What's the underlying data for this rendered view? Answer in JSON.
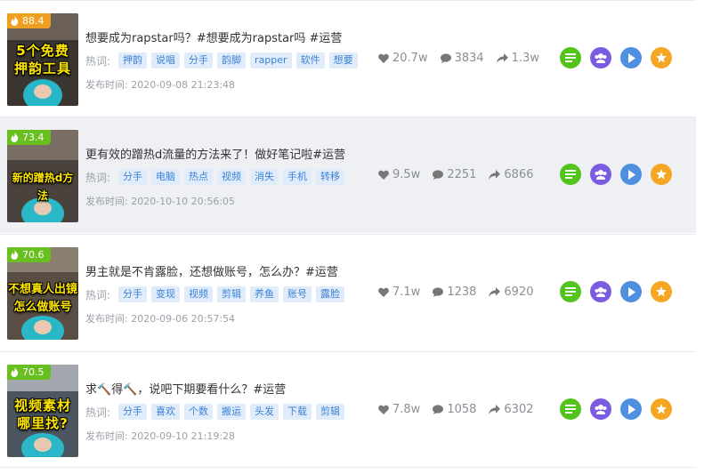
{
  "heat_label_icon": "flame-icon",
  "tags_label": "热词:",
  "time_label": "发布时间:",
  "actions": [
    "list-icon",
    "users-icon",
    "play-icon",
    "star-icon"
  ],
  "items": [
    {
      "heat": "88.4",
      "heat_color": "#f0a020",
      "thumb_text_1": "5个免费",
      "thumb_text_2": "押韵工具",
      "title": "想要成为rapstar吗？#想要成为rapstar吗 #运营",
      "tags": [
        "押韵",
        "说唱",
        "分手",
        "韵脚",
        "rapper",
        "软件",
        "想要"
      ],
      "likes": "20.7w",
      "comments": "3834",
      "shares": "1.3w",
      "time": "2020-09-08 21:23:48"
    },
    {
      "heat": "73.4",
      "heat_color": "#6abf20",
      "thumb_text_1": "新的蹭热d方法",
      "thumb_text_2": "",
      "title": "更有效的蹭热d流量的方法来了！做好笔记啦#运营",
      "tags": [
        "分手",
        "电脑",
        "热点",
        "视频",
        "消失",
        "手机",
        "转移"
      ],
      "likes": "9.5w",
      "comments": "2251",
      "shares": "6866",
      "time": "2020-10-10 20:56:05"
    },
    {
      "heat": "70.6",
      "heat_color": "#6abf20",
      "thumb_text_1": "不想真人出镜",
      "thumb_text_2": "怎么做账号",
      "title": "男主就是不肯露脸，还想做账号，怎么办？#运营",
      "tags": [
        "分手",
        "变现",
        "视频",
        "剪辑",
        "养鱼",
        "账号",
        "露脸"
      ],
      "likes": "7.1w",
      "comments": "1238",
      "shares": "6920",
      "time": "2020-09-06 20:57:54"
    },
    {
      "heat": "70.5",
      "heat_color": "#6abf20",
      "thumb_text_1": "视频素材",
      "thumb_text_2": "哪里找?",
      "title": "求🔨得🔨，说吧下期要看什么？#运营",
      "tags": [
        "分手",
        "喜欢",
        "个数",
        "搬运",
        "头发",
        "下载",
        "剪辑"
      ],
      "likes": "7.8w",
      "comments": "1058",
      "shares": "6302",
      "time": "2020-09-10 21:19:28"
    }
  ]
}
